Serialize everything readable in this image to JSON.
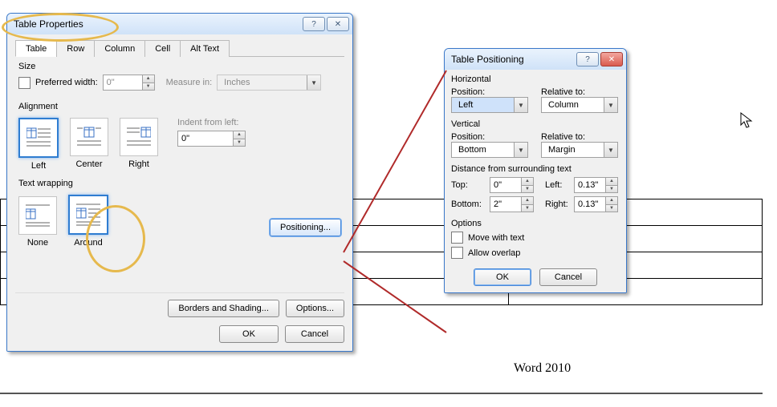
{
  "caption": "Word 2010",
  "table_properties": {
    "title": "Table Properties",
    "tabs": [
      "Table",
      "Row",
      "Column",
      "Cell",
      "Alt Text"
    ],
    "active_tab": 0,
    "size": {
      "legend": "Size",
      "preferred_width_label": "Preferred width:",
      "preferred_width_value": "0\"",
      "measure_in_label": "Measure in:",
      "measure_in_value": "Inches"
    },
    "alignment": {
      "legend": "Alignment",
      "options": [
        "Left",
        "Center",
        "Right"
      ],
      "selected": 0,
      "indent_label": "Indent from left:",
      "indent_value": "0\""
    },
    "wrapping": {
      "legend": "Text wrapping",
      "options": [
        "None",
        "Around"
      ],
      "selected": 1,
      "positioning_btn": "Positioning..."
    },
    "borders_btn": "Borders and Shading...",
    "options_btn": "Options...",
    "ok": "OK",
    "cancel": "Cancel"
  },
  "table_positioning": {
    "title": "Table Positioning",
    "horizontal": {
      "legend": "Horizontal",
      "position_label": "Position:",
      "position_value": "Left",
      "relative_label": "Relative to:",
      "relative_value": "Column"
    },
    "vertical": {
      "legend": "Vertical",
      "position_label": "Position:",
      "position_value": "Bottom",
      "relative_label": "Relative to:",
      "relative_value": "Margin"
    },
    "distance": {
      "legend": "Distance from surrounding text",
      "top_label": "Top:",
      "top_value": "0\"",
      "bottom_label": "Bottom:",
      "bottom_value": "2\"",
      "left_label": "Left:",
      "left_value": "0.13\"",
      "right_label": "Right:",
      "right_value": "0.13\""
    },
    "options": {
      "legend": "Options",
      "move_with_text": "Move with text",
      "allow_overlap": "Allow overlap"
    },
    "ok": "OK",
    "cancel": "Cancel"
  }
}
